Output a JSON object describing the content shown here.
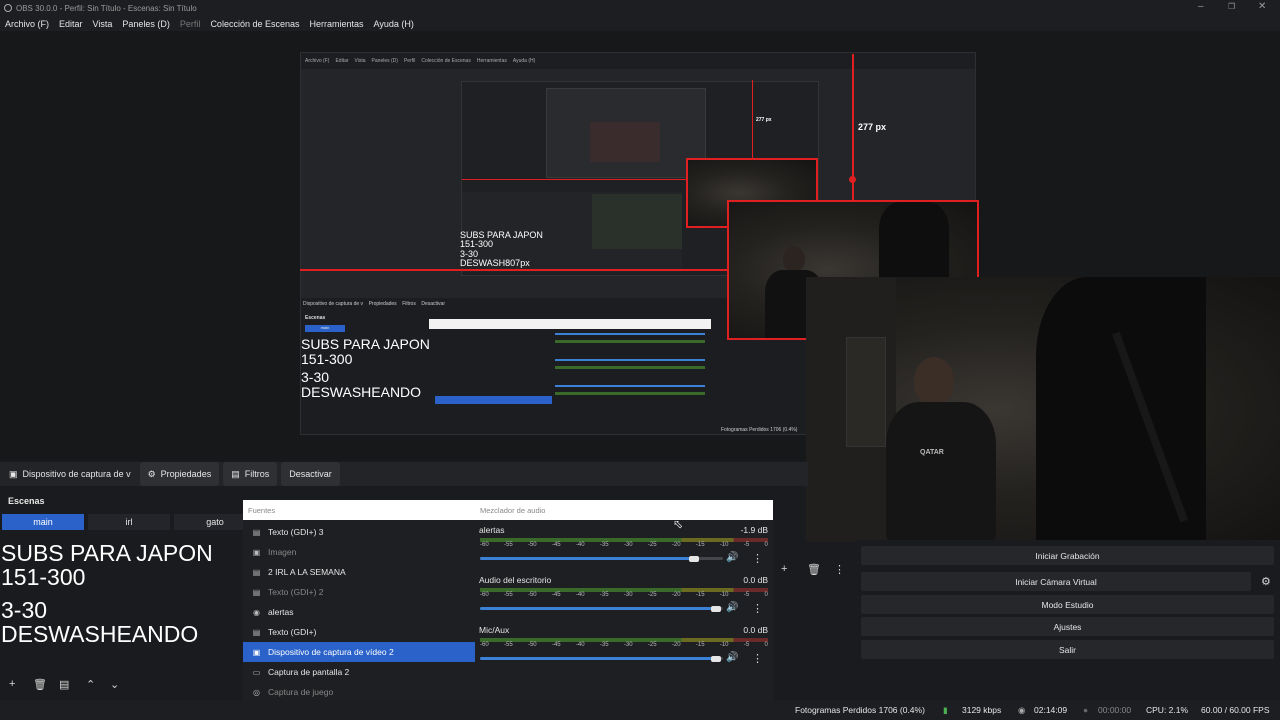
{
  "titlebar": {
    "title": "OBS 30.0.0 - Perfil: Sin Título - Escenas: Sin Título"
  },
  "menu": [
    {
      "label": "Archivo (F)",
      "dim": false
    },
    {
      "label": "Editar",
      "dim": false
    },
    {
      "label": "Vista",
      "dim": false
    },
    {
      "label": "Paneles (D)",
      "dim": false
    },
    {
      "label": "Perfil",
      "dim": true
    },
    {
      "label": "Colección de Escenas",
      "dim": false
    },
    {
      "label": "Herramientas",
      "dim": false
    },
    {
      "label": "Ayuda (H)",
      "dim": false
    }
  ],
  "preview": {
    "px_label_1": "277 px",
    "px_label_2": "277 px",
    "nested_text": {
      "line1": "SUBS PARA JAPON",
      "line2": "151-300",
      "line3": "3-30",
      "line4": "DESWASHEANDO"
    },
    "small_text": {
      "line1": "SUBS PARA JAPON",
      "line2": "151-300",
      "line3": "3-30",
      "line4": "DESWASH807px"
    }
  },
  "source_bar": {
    "source_name": "Dispositivo de captura de v",
    "properties": "Propiedades",
    "filters": "Filtros",
    "deactivate": "Desactivar"
  },
  "scenes": {
    "title": "Escenas",
    "items": [
      "main",
      "irl",
      "gato"
    ],
    "overlay": {
      "line1": "SUBS PARA JAPON",
      "line2": "151-300",
      "line3": "3-30",
      "line4": "DESWASHEANDO"
    }
  },
  "sources": {
    "header": "Fuentes",
    "items": [
      {
        "label": "Texto (GDI+) 3",
        "icon": "text-icon",
        "state": "normal"
      },
      {
        "label": "Imagen",
        "icon": "image-icon",
        "state": "dim"
      },
      {
        "label": "2 IRL A LA SEMANA",
        "icon": "text-icon",
        "state": "normal"
      },
      {
        "label": "Texto (GDI+) 2",
        "icon": "text-icon",
        "state": "dim"
      },
      {
        "label": "alertas",
        "icon": "browser-icon",
        "state": "normal"
      },
      {
        "label": "Texto (GDI+)",
        "icon": "text-icon",
        "state": "normal"
      },
      {
        "label": "Dispositivo de captura de vídeo 2",
        "icon": "camera-icon",
        "state": "selected"
      },
      {
        "label": "Captura de pantalla 2",
        "icon": "monitor-icon",
        "state": "normal"
      },
      {
        "label": "Captura de juego",
        "icon": "gamepad-icon",
        "state": "dim"
      }
    ]
  },
  "mixer": {
    "header": "Mezclador de audio",
    "scale": [
      "-60",
      "-55",
      "-50",
      "-45",
      "-40",
      "-35",
      "-30",
      "-25",
      "-20",
      "-15",
      "-10",
      "-5",
      "0"
    ],
    "channels": [
      {
        "name": "alertas",
        "db": "-1.9 dB",
        "volume": 0.88
      },
      {
        "name": "Audio del escritorio",
        "db": "0.0 dB",
        "volume": 0.97
      },
      {
        "name": "Mic/Aux",
        "db": "0.0 dB",
        "volume": 0.97
      }
    ]
  },
  "controls": {
    "buttons": [
      "Iniciar Grabación",
      "Iniciar Cámara Virtual",
      "Modo Estudio",
      "Ajustes",
      "Salir"
    ]
  },
  "status": {
    "dropped": "Fotogramas Perdidos 1706 (0.4%)",
    "bitrate": "3129 kbps",
    "stream_time": "02:14:09",
    "rec_time": "00:00:00",
    "cpu": "CPU: 2.1%",
    "fps": "60.00 / 60.00 FPS"
  }
}
